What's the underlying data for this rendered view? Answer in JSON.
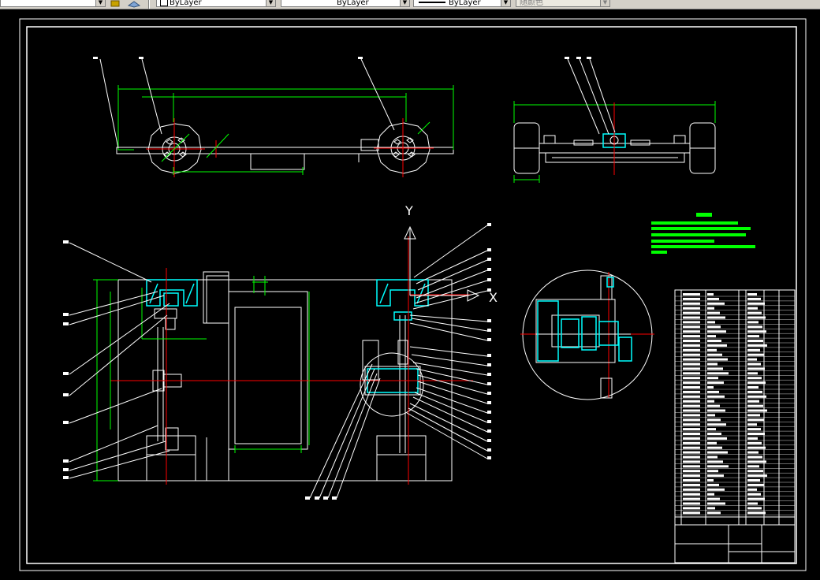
{
  "toolbar": {
    "color_combo": "ByLayer",
    "linetype_combo": "ByLayer",
    "lineweight_combo": "ByLayer",
    "plotstyle_combo": "随颜色"
  },
  "drawing": {
    "axis_y_label": "Y",
    "axis_x_label": "X",
    "colors": {
      "outline": "#ffffff",
      "dimension": "#00ff00",
      "center": "#ff0000",
      "hatch": "#00ffff",
      "leader": "#ffffff"
    }
  }
}
